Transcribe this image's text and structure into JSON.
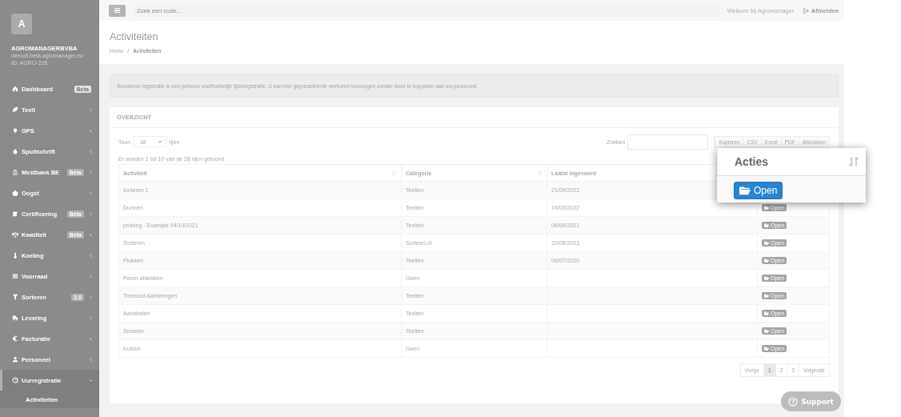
{
  "sidebar": {
    "avatar": "A",
    "company": "AGROMANAGERBVBA",
    "domain": "demo8.beta.agromanager.eu",
    "id": "ID: AGRO-228",
    "items": [
      {
        "label": "Dashboard",
        "kind": "link",
        "badge": "Beta",
        "selected": false
      },
      {
        "label": "Teelt",
        "kind": "menu",
        "selected": false,
        "expanded": false
      },
      {
        "label": "GPS",
        "kind": "menu",
        "selected": false,
        "expanded": false
      },
      {
        "label": "Spuitschrift",
        "kind": "menu",
        "selected": false,
        "expanded": false
      },
      {
        "label": "Mestbank BE",
        "kind": "menu",
        "badge": "Bèta",
        "selected": false,
        "expanded": false
      },
      {
        "label": "Oogst",
        "kind": "menu",
        "selected": false,
        "expanded": false
      },
      {
        "label": "Certificering",
        "kind": "menu",
        "badge": "Bèta",
        "selected": false,
        "expanded": false
      },
      {
        "label": "Kwaliteit",
        "kind": "menu",
        "badge": "Bèta",
        "selected": false,
        "expanded": false
      },
      {
        "label": "Koeling",
        "kind": "menu",
        "selected": false,
        "expanded": false
      },
      {
        "label": "Voorraad",
        "kind": "menu",
        "selected": false,
        "expanded": false
      },
      {
        "label": "Sorteren",
        "kind": "menu",
        "badge": "2.0",
        "selected": false,
        "expanded": false
      },
      {
        "label": "Levering",
        "kind": "menu",
        "selected": false,
        "expanded": false
      },
      {
        "label": "Facturatie",
        "kind": "menu",
        "selected": false,
        "expanded": false
      },
      {
        "label": "Personeel",
        "kind": "menu",
        "selected": false,
        "expanded": false
      },
      {
        "label": "Uurregistratie",
        "kind": "menu",
        "selected": true,
        "expanded": true,
        "children": [
          {
            "label": "Activiteiten",
            "selected": true
          }
        ]
      }
    ]
  },
  "topbar": {
    "search_placeholder": "Zoek een code...",
    "welcome": "Welkom bij Agromanager.",
    "logout": "Afmelden"
  },
  "header": {
    "title": "Activiteiten",
    "breadcrumb": [
      "Home",
      "Activiteiten"
    ],
    "breadcrumb_separator": "/"
  },
  "alert": "Anonieme registratie is een persoon onafhankelijk tijdsregistratie. U kan hier gepreseteerde werkuren toevoegen zonder deze te koppelen aan uw personeel.",
  "panel": {
    "title": "OVERZICHT",
    "show_label": "Toon",
    "page_size": "10",
    "rows_label": "rijen",
    "search_label": "Zoeken",
    "export_buttons": [
      "Kopieren",
      "CSV",
      "Excel",
      "PDF",
      "Afdrukken"
    ],
    "info": "Er worden 1 tot 10 van de 28 rijen getoond",
    "table": {
      "columns": [
        "Activiteit",
        "Categorie",
        "Laatst ingevoerd"
      ],
      "rows": [
        {
          "cells": [
            "sorteren 1",
            "Teelten",
            "21/09/2022"
          ]
        },
        {
          "cells": [
            "Dunnen",
            "Teelten",
            "14/03/2022"
          ],
          "action": "Open"
        },
        {
          "cells": [
            "pruning - Example 04/10/2021",
            "Teelten",
            "06/09/2021"
          ],
          "action": "Open"
        },
        {
          "cells": [
            "Sorteren",
            "SorteerLot",
            "20/08/2021"
          ],
          "action": "Open"
        },
        {
          "cells": [
            "Plukken",
            "Teelten",
            "06/07/2020"
          ],
          "action": "Open"
        },
        {
          "cells": [
            "Peren afdekken",
            "Geen",
            ""
          ],
          "action": "Open"
        },
        {
          "cells": [
            "Treecoat Aanbrengen",
            "Teelten",
            ""
          ],
          "action": "Open"
        },
        {
          "cells": [
            "Aanbinden",
            "Teelten",
            ""
          ],
          "action": "Open"
        },
        {
          "cells": [
            "Snoeien",
            "Teelten",
            ""
          ],
          "action": "Open"
        },
        {
          "cells": [
            "Kuisen",
            "Geen",
            ""
          ],
          "action": "Open"
        }
      ]
    },
    "pagination": [
      {
        "label": "Vorige",
        "selected": false
      },
      {
        "label": "1",
        "selected": true
      },
      {
        "label": "2",
        "selected": false
      },
      {
        "label": "3",
        "selected": false
      },
      {
        "label": "Volgende",
        "selected": false
      }
    ]
  },
  "callout": {
    "column": "Acties",
    "button": "Open"
  },
  "support": "Support"
}
